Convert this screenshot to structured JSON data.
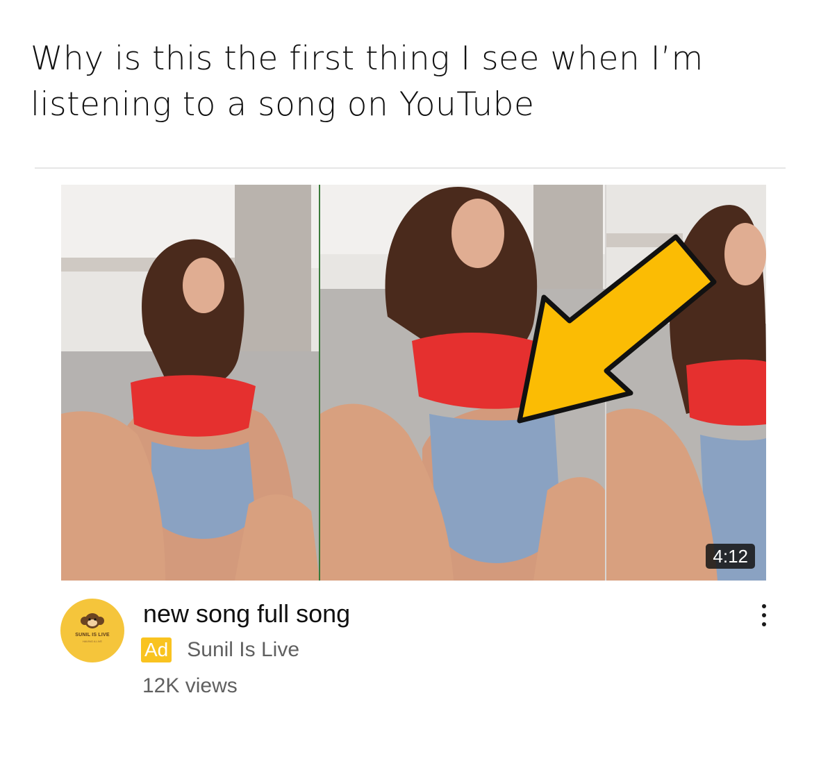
{
  "post": {
    "caption": "Why is this the first thing I see when I’m listening to a song on YouTube"
  },
  "video": {
    "duration": "4:12",
    "title": "new song full song",
    "ad_label": "Ad",
    "channel": "Sunil Is Live",
    "views": "12K views",
    "thumbnail_icon": "arrow-pointer-graphic",
    "more_icon": "vertical-ellipsis-icon"
  },
  "avatar": {
    "label": "SUNIL IS LIVE",
    "sublabel": "HAVING A LIVE",
    "icon": "monkey-logo-icon",
    "color": "#f5c53b"
  },
  "colors": {
    "ad_badge": "#f9c320",
    "arrow": "#fbbc04",
    "top_red": "#e5302f",
    "denim": "#8aa2c2"
  }
}
